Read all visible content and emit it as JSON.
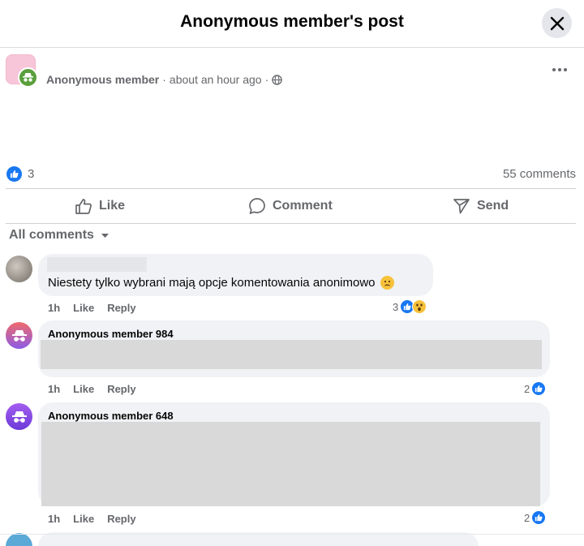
{
  "header": {
    "title": "Anonymous member's post"
  },
  "post": {
    "author": "Anonymous member",
    "time_text": "about an hour ago",
    "separator": "·",
    "like_count": "3",
    "comment_count": "55 comments"
  },
  "actions": {
    "like": "Like",
    "comment": "Comment",
    "send": "Send"
  },
  "sort": {
    "label": "All comments"
  },
  "comments": [
    {
      "author": "",
      "text": "Niestety tylko wybrani mają opcje komentowania anonimowo",
      "time": "1h",
      "like": "Like",
      "reply": "Reply",
      "reaction_count": "3"
    },
    {
      "author": "Anonymous member 984",
      "text": "",
      "time": "1h",
      "like": "Like",
      "reply": "Reply",
      "reaction_count": "2"
    },
    {
      "author": "Anonymous member 648",
      "text": "",
      "time": "1h",
      "like": "Like",
      "reply": "Reply",
      "reaction_count": "2"
    }
  ],
  "colors": {
    "accent": "#1877f2",
    "bubble": "#f0f2f5",
    "muted": "#65676b"
  },
  "icons": [
    "close-icon",
    "more-icon",
    "anonymous-icon",
    "globe-icon",
    "like-icon",
    "comment-icon",
    "send-icon",
    "chevron-down-icon",
    "wow-icon",
    "sad-emoji"
  ]
}
